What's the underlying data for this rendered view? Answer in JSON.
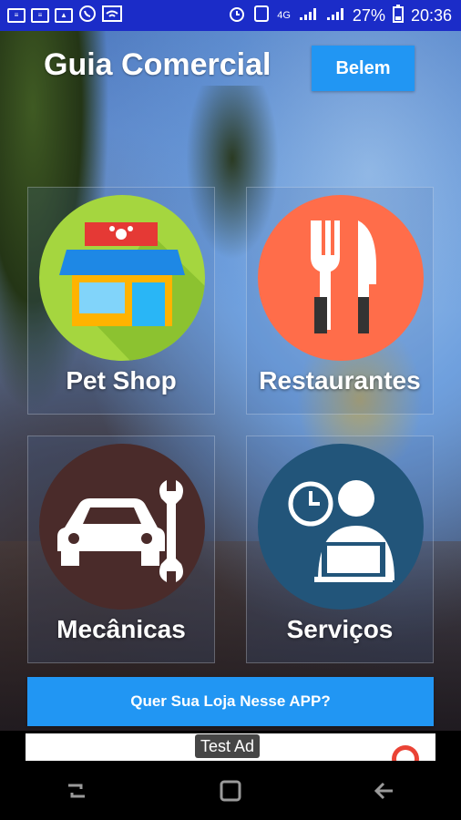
{
  "status_bar": {
    "left_icons": [
      "gallery-icon",
      "gallery-icon",
      "image-icon",
      "whatsapp-icon",
      "wifi-icon"
    ],
    "right_icons": [
      "alarm-icon",
      "nfc-icon",
      "signal-4g-icon",
      "signal-icon"
    ],
    "network_label": "4G",
    "battery": "27%",
    "time": "20:36"
  },
  "header": {
    "title": "Guia Comercial",
    "city_button": "Belem"
  },
  "categories": [
    {
      "label": "Pet Shop",
      "icon": "pet-shop-icon",
      "color": "#a5d63f"
    },
    {
      "label": "Restaurantes",
      "icon": "fork-knife-icon",
      "color": "#ff6d4a"
    },
    {
      "label": "Mecânicas",
      "icon": "car-wrench-icon",
      "color": "#4a2b2a"
    },
    {
      "label": "Serviços",
      "icon": "person-laptop-icon",
      "color": "#22557a"
    }
  ],
  "cta": {
    "label": "Quer Sua Loja Nesse APP?"
  },
  "ad": {
    "label": "Test Ad"
  },
  "colors": {
    "statusbar": "#1b2cc8",
    "accent": "#2196f3",
    "navbar": "#000000"
  }
}
